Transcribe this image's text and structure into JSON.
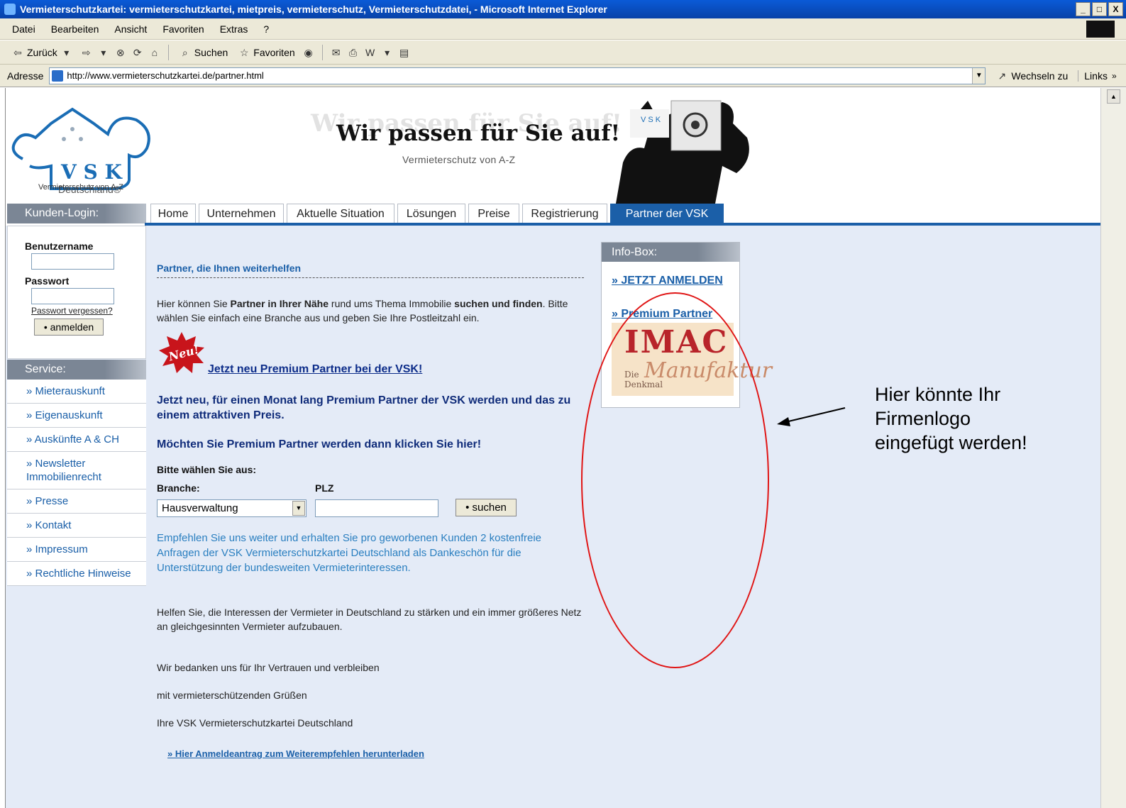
{
  "window": {
    "title": "Vermieterschutzkartei: vermieterschutzkartei, mietpreis, vermieterschutz, Vermieterschutzdatei, - Microsoft Internet Explorer",
    "controls": [
      "_",
      "□",
      "X"
    ]
  },
  "menu": [
    "Datei",
    "Bearbeiten",
    "Ansicht",
    "Favoriten",
    "Extras",
    "?"
  ],
  "toolbar": {
    "back_label": "Zurück",
    "search_label": "Suchen",
    "favorites_label": "Favoriten"
  },
  "address": {
    "label": "Adresse",
    "url": "http://www.vermieterschutzkartei.de/partner.html",
    "go_label": "Wechseln zu",
    "links_label": "Links"
  },
  "header": {
    "logo_letters": "V S K",
    "logo_country": "Deutschland®",
    "logo_tagline": "Vermieterschutz von A-Z",
    "title": "Wir passen für Sie auf!",
    "subtitle": "Vermieterschutz von A-Z"
  },
  "nav": {
    "tabs": [
      "Home",
      "Unternehmen",
      "Aktuelle Situation",
      "Lösungen",
      "Preise",
      "Registrierung",
      "Partner der VSK"
    ],
    "active": "Partner der VSK"
  },
  "sidebar": {
    "login_title": "Kunden-Login:",
    "username_label": "Benutzername",
    "password_label": "Passwort",
    "forgot_link": "Passwort vergessen?",
    "login_button": "• anmelden",
    "service_title": "Service:",
    "service_items": [
      "» Mieterauskunft",
      "» Eigenauskunft",
      "» Auskünfte A & CH",
      "» Newsletter Immobilienrecht",
      "» Presse",
      "» Kontakt",
      "» Impressum",
      "» Rechtliche Hinweise"
    ]
  },
  "main": {
    "section_title": "Partner, die Ihnen weiterhelfen",
    "intro_1": "Hier können Sie ",
    "intro_bold_1": "Partner in Ihrer Nähe",
    "intro_2": " rund ums Thema Immobilie ",
    "intro_bold_2": "suchen und finden",
    "intro_3": ". Bitte wählen Sie einfach eine Branche aus und geben Sie Ihre Postleitzahl ein.",
    "neu_badge": "Neu!",
    "premium_link": "Jetzt neu Premium Partner bei der VSK!",
    "premium_text": "Jetzt neu, für einen Monat lang Premium Partner der VSK werden und das zu einem attraktiven Preis.",
    "premium_cta": "Möchten Sie Premium Partner werden dann klicken Sie hier!",
    "choose_label": "Bitte wählen Sie aus:",
    "branche_label": "Branche:",
    "plz_label": "PLZ",
    "branche_value": "Hausverwaltung",
    "search_button": "• suchen",
    "recommend_text": "Empfehlen Sie uns weiter und erhalten Sie pro geworbenen Kunden 2 kostenfreie Anfragen der VSK Vermieterschutzkartei Deutschland als Dankeschön für die Unterstützung der bundesweiten Vermieterinteressen.",
    "help_text": "Helfen Sie, die Interessen der Vermieter in Deutschland zu stärken und ein immer größeres Netz an gleichgesinnten Vermieter aufzubauen.",
    "thanks_text": "Wir bedanken uns für Ihr Vertrauen und verbleiben",
    "greeting_text": "mit vermieterschützenden Grüßen",
    "signature_text": "Ihre VSK Vermieterschutzkartei Deutschland",
    "download_link": "» Hier Anmeldeantrag zum Weiterempfehlen herunterladen"
  },
  "infobox": {
    "title": "Info-Box:",
    "link_register": "» JETZT ANMELDEN",
    "link_premium": "» Premium Partner",
    "partner_logo_text": "IMAC",
    "partner_logo_sub1": "Die",
    "partner_logo_sub2": "Manufaktur",
    "partner_logo_sub3": "Denkmal"
  },
  "annotation": {
    "text_line1": "Hier könnte Ihr",
    "text_line2": "Firmenlogo",
    "text_line3": "eingefügt werden!",
    "color": "#e01515"
  },
  "colors": {
    "accent": "#1b5fa8",
    "content_bg": "#e4ebf7",
    "side_head": "#7b8695"
  }
}
